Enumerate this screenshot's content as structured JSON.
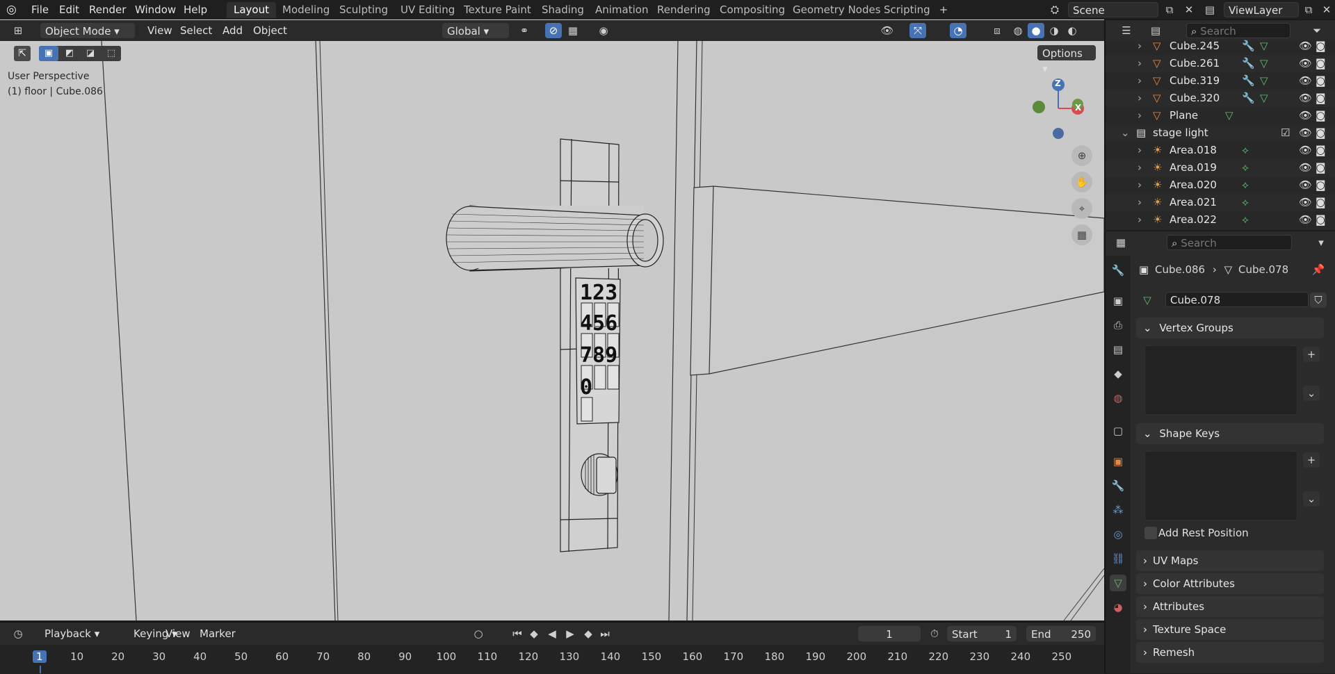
{
  "menu": [
    "File",
    "Edit",
    "Render",
    "Window",
    "Help"
  ],
  "workspaces": [
    "Layout",
    "Modeling",
    "Sculpting",
    "UV Editing",
    "Texture Paint",
    "Shading",
    "Animation",
    "Rendering",
    "Compositing",
    "Geometry Nodes",
    "Scripting"
  ],
  "active_workspace": "Layout",
  "scene": "Scene",
  "view_layer": "ViewLayer",
  "viewport": {
    "mode": "Object Mode",
    "menus": [
      "View",
      "Select",
      "Add",
      "Object"
    ],
    "orientation": "Global",
    "options_label": "Options",
    "info_line1": "User Perspective",
    "info_line2": "(1) floor | Cube.086",
    "keypad_rows": [
      "123",
      "456",
      "789",
      "0"
    ],
    "gizmo": {
      "z": "Z",
      "x": "X"
    }
  },
  "outliner": {
    "search_placeholder": "Search",
    "rows": [
      {
        "name": "Cube.245",
        "kind": "mesh"
      },
      {
        "name": "Cube.261",
        "kind": "mesh"
      },
      {
        "name": "Cube.319",
        "kind": "mesh"
      },
      {
        "name": "Cube.320",
        "kind": "mesh"
      },
      {
        "name": "Plane",
        "kind": "mesh"
      },
      {
        "name": "stage light",
        "kind": "collection"
      },
      {
        "name": "Area.018",
        "kind": "light"
      },
      {
        "name": "Area.019",
        "kind": "light"
      },
      {
        "name": "Area.020",
        "kind": "light"
      },
      {
        "name": "Area.021",
        "kind": "light"
      },
      {
        "name": "Area.022",
        "kind": "light"
      }
    ]
  },
  "properties": {
    "search_placeholder": "Search",
    "breadcrumb_object": "Cube.086",
    "breadcrumb_data": "Cube.078",
    "data_name": "Cube.078",
    "panels": {
      "vertex_groups": "Vertex Groups",
      "shape_keys": "Shape Keys",
      "add_rest_position": "Add Rest Position",
      "uv_maps": "UV Maps",
      "color_attributes": "Color Attributes",
      "attributes": "Attributes",
      "texture_space": "Texture Space",
      "remesh": "Remesh"
    }
  },
  "timeline": {
    "menus": [
      "Playback",
      "Keying",
      "View",
      "Marker"
    ],
    "current_frame": "1",
    "start_label": "Start",
    "start": "1",
    "end_label": "End",
    "end": "250",
    "ticks": [
      "1",
      "10",
      "20",
      "30",
      "40",
      "50",
      "60",
      "70",
      "80",
      "90",
      "100",
      "110",
      "120",
      "130",
      "140",
      "150",
      "160",
      "170",
      "180",
      "190",
      "200",
      "210",
      "220",
      "230",
      "240",
      "250"
    ]
  },
  "colors": {
    "accent_blue": "#4772b3",
    "mesh_orange": "#e08c48",
    "data_green": "#5fbf6f",
    "viewport_bg": "#c9c9c9"
  }
}
